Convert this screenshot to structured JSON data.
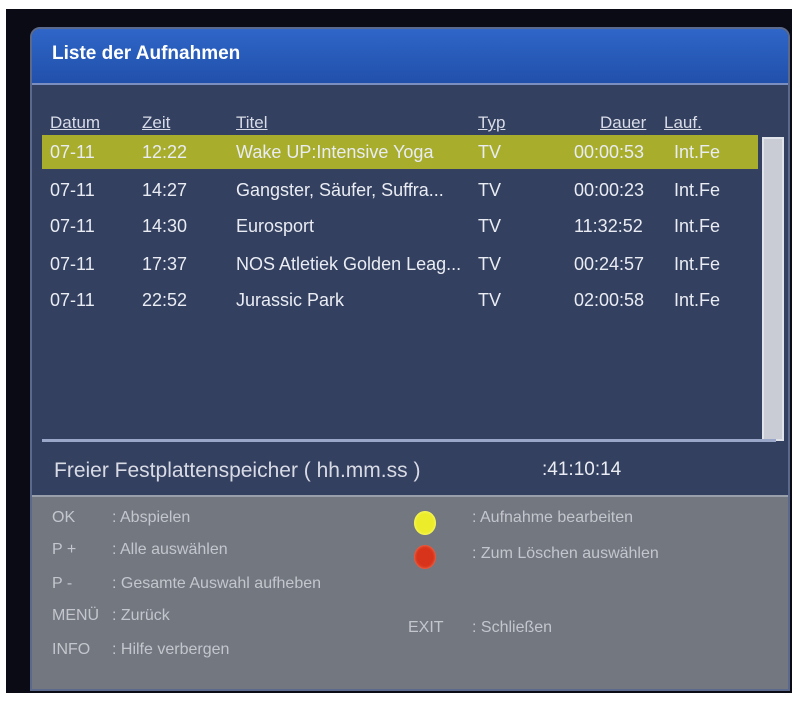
{
  "window": {
    "title": "Liste der Aufnahmen"
  },
  "columns": {
    "datum": "Datum",
    "zeit": "Zeit",
    "titel": "Titel",
    "typ": "Typ",
    "dauer": "Dauer",
    "lauf": "Lauf."
  },
  "recordings": [
    {
      "datum": "07-11",
      "zeit": "12:22",
      "titel": "Wake UP:Intensive Yoga",
      "typ": "TV",
      "dauer": "00:00:53",
      "lauf": "Int.Fe",
      "selected": true
    },
    {
      "datum": "07-11",
      "zeit": "14:27",
      "titel": "Gangster, Säufer, Suffra...",
      "typ": "TV",
      "dauer": "00:00:23",
      "lauf": "Int.Fe",
      "selected": false
    },
    {
      "datum": "07-11",
      "zeit": "14:30",
      "titel": "Eurosport",
      "typ": "TV",
      "dauer": "11:32:52",
      "lauf": "Int.Fe",
      "selected": false
    },
    {
      "datum": "07-11",
      "zeit": "17:37",
      "titel": "NOS Atletiek Golden Leag...",
      "typ": "TV",
      "dauer": "00:24:57",
      "lauf": "Int.Fe",
      "selected": false
    },
    {
      "datum": "07-11",
      "zeit": "22:52",
      "titel": "Jurassic Park",
      "typ": "TV",
      "dauer": "02:00:58",
      "lauf": "Int.Fe",
      "selected": false
    }
  ],
  "storage": {
    "label": "Freier Festplattenspeicher ( hh.mm.ss )",
    "value": ":41:10:14"
  },
  "help": {
    "ok_key": "OK",
    "ok_desc": ": Abspielen",
    "pplus_key": "P +",
    "pplus_desc": ": Alle auswählen",
    "pminus_key": "P -",
    "pminus_desc": ": Gesamte Auswahl aufheben",
    "menu_key": "MENÜ",
    "menu_desc": ": Zurück",
    "info_key": "INFO",
    "info_desc": ": Hilfe verbergen",
    "yellow_desc": ": Aufnahme bearbeiten",
    "red_desc": ": Zum Löschen auswählen",
    "exit_key": "EXIT",
    "exit_desc": ": Schließen"
  },
  "colors": {
    "title_bar": "#2f66c8",
    "panel": "#34405f",
    "selection": "#a8ad2c",
    "help_panel": "#737780",
    "yellow_button": "#ecec2a",
    "red_button": "#d8331b"
  }
}
